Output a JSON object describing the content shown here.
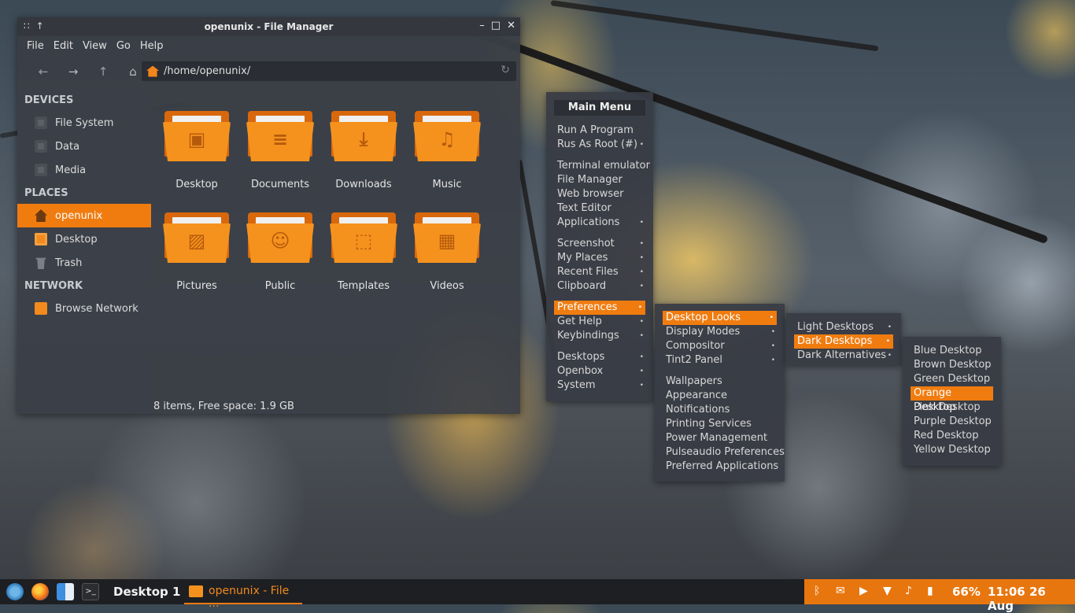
{
  "window": {
    "title": "openunix - File Manager",
    "menubar": [
      "File",
      "Edit",
      "View",
      "Go",
      "Help"
    ],
    "address": "/home/openunix/",
    "status": "8 items, Free space: 1.9 GB"
  },
  "sidebar": {
    "devices_header": "DEVICES",
    "devices": [
      "File System",
      "Data",
      "Media"
    ],
    "places_header": "PLACES",
    "places": [
      "openunix",
      "Desktop",
      "Trash"
    ],
    "network_header": "NETWORK",
    "network": [
      "Browse Network"
    ]
  },
  "folders": [
    "Desktop",
    "Documents",
    "Downloads",
    "Music",
    "Pictures",
    "Public",
    "Templates",
    "Videos"
  ],
  "main_menu": {
    "title": "Main Menu",
    "items": [
      "Run A Program",
      "Rus As Root (#)",
      "Terminal emulator",
      "File Manager",
      "Web browser",
      "Text Editor",
      "Applications",
      "Screenshot",
      "My Places",
      "Recent Files",
      "Clipboard",
      "Preferences",
      "Get Help",
      "Keybindings",
      "Desktops",
      "Openbox",
      "System"
    ]
  },
  "prefs_menu": {
    "items": [
      "Desktop Looks",
      "Display Modes",
      "Compositor",
      "Tint2 Panel",
      "Wallpapers",
      "Appearance",
      "Notifications",
      "Printing Services",
      "Power Management",
      "Pulseaudio Preferences",
      "Preferred Applications"
    ]
  },
  "looks_menu": {
    "items": [
      "Light Desktops",
      "Dark Desktops",
      "Dark Alternatives"
    ]
  },
  "dark_menu": {
    "items": [
      "Blue Desktop",
      "Brown Desktop",
      "Green Desktop",
      "Orange Desktop",
      "Pink Desktop",
      "Purple Desktop",
      "Red Desktop",
      "Yellow Desktop"
    ]
  },
  "taskbar": {
    "desktop_label": "Desktop 1",
    "task_label": "openunix - File ...",
    "battery": "66%",
    "clock": "11:06 26 Aug"
  },
  "colors": {
    "accent": "#f07c10",
    "panel": "#3a3e46"
  }
}
